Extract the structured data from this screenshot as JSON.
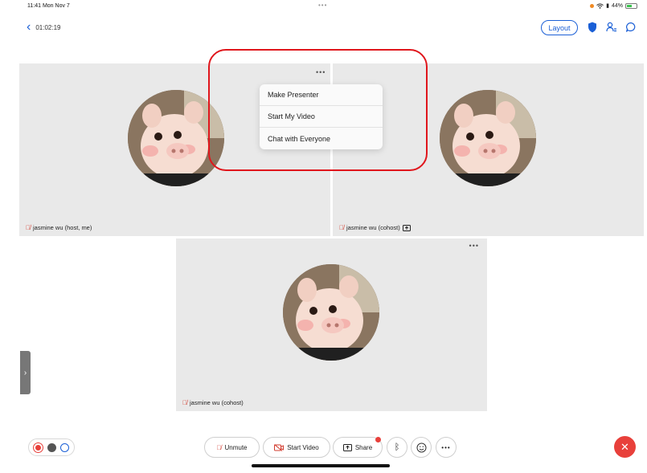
{
  "status": {
    "time": "11:41",
    "date": "Mon Nov 7",
    "battery": "44%"
  },
  "header": {
    "elapsed": "01:02:19",
    "layout_label": "Layout"
  },
  "tiles": [
    {
      "name": "jasmine wu (host, me)"
    },
    {
      "name": "jasmine wu (cohost)"
    },
    {
      "name": "jasmine wu (cohost)"
    }
  ],
  "menu": {
    "items": [
      "Make Presenter",
      "Start My Video",
      "Chat with Everyone"
    ]
  },
  "toolbar": {
    "unmute": "Unmute",
    "start_video": "Start Video",
    "share": "Share"
  },
  "colors": {
    "accent": "#1a5fd6",
    "leave": "#e8403b",
    "highlight": "#e0161c",
    "tile_bg": "#e9e9e9"
  }
}
